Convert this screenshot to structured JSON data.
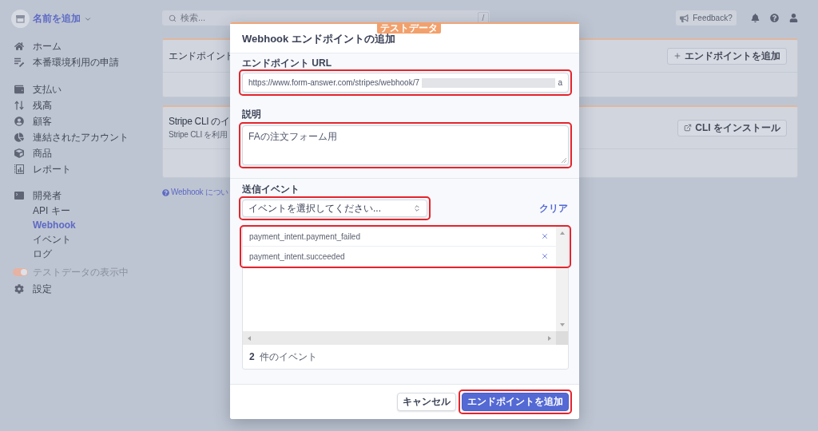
{
  "account": {
    "name": "名前を追加"
  },
  "sidebar": {
    "groups": [
      {
        "items": [
          {
            "label": "ホーム",
            "selected": false
          },
          {
            "label": "本番環境利用の申請",
            "selected": false
          }
        ]
      },
      {
        "items": [
          {
            "label": "支払い",
            "selected": false
          },
          {
            "label": "残高",
            "selected": false
          },
          {
            "label": "顧客",
            "selected": false
          },
          {
            "label": "連結されたアカウント",
            "selected": false
          },
          {
            "label": "商品",
            "selected": false
          },
          {
            "label": "レポート",
            "selected": false
          }
        ]
      },
      {
        "items": [
          {
            "label": "開発者",
            "selected": false,
            "children": [
              {
                "label": "API キー",
                "selected": false
              },
              {
                "label": "Webhook",
                "selected": true
              },
              {
                "label": "イベント",
                "selected": false
              },
              {
                "label": "ログ",
                "selected": false
              }
            ]
          }
        ]
      }
    ],
    "test_mode": {
      "label": "テストデータの表示中",
      "on": true
    },
    "settings": {
      "label": "設定"
    }
  },
  "top_bar": {
    "search": {
      "placeholder": "検索...",
      "shortcut": "/"
    },
    "feedback": "Feedback?"
  },
  "cards": [
    {
      "title": "エンドポイント",
      "button": {
        "label": "エンドポイントを追加",
        "kind": "add"
      }
    },
    {
      "title": "Stripe CLI のイ",
      "subtitle": "Stripe CLI を利用",
      "button": {
        "label": "CLI をインストール",
        "kind": "external"
      }
    }
  ],
  "help_link": "Webhook につい",
  "modal": {
    "badge": "テストデータ",
    "title": "Webhook エンドポイントの追加",
    "url": {
      "label": "エンドポイント URL",
      "value": "https://www.form-answer.com/stripes/webhook/7",
      "redacted": true,
      "value_end": "a",
      "highlighted": true
    },
    "description": {
      "label": "説明",
      "value": "FAの注文フォーム用",
      "highlighted": true
    },
    "events": {
      "label": "送信イベント",
      "select": {
        "value": "イベントを選択してください...",
        "highlighted": true
      },
      "clear": "クリア",
      "items": [
        {
          "name": "payment_intent.payment_failed"
        },
        {
          "name": "payment_intent.succeeded"
        }
      ],
      "items_highlighted": true,
      "count": "**2** 件のイベント"
    },
    "buttons": [
      {
        "label": "キャンセル",
        "kind": "secondary",
        "highlighted": false
      },
      {
        "label": "エンドポイントを追加",
        "kind": "primary",
        "highlighted": true
      }
    ]
  }
}
